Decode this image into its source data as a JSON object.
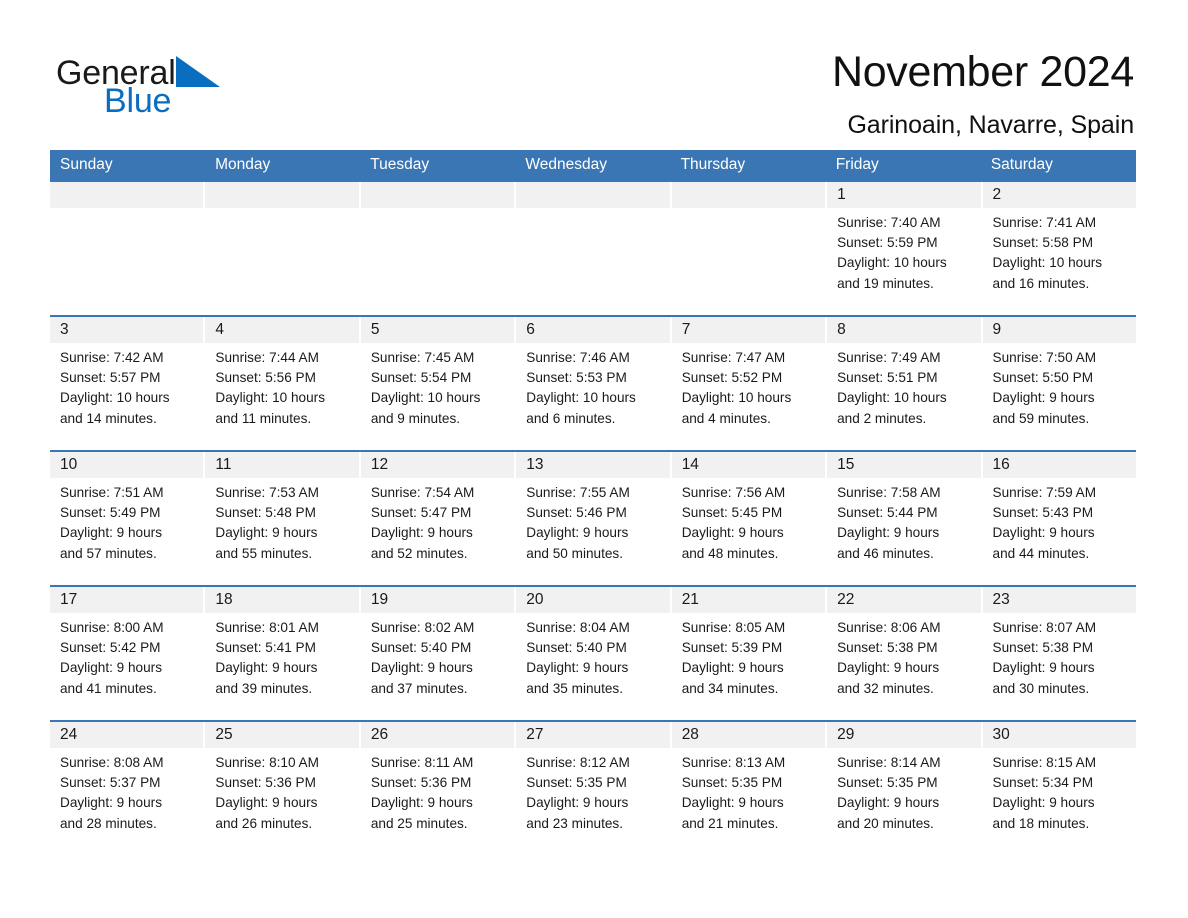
{
  "brand": {
    "name_part1": "General",
    "name_part2": "Blue",
    "logo_icon": "triangle-mark",
    "accent_color": "#0a6ec0"
  },
  "header": {
    "month_title": "November 2024",
    "location": "Garinoain, Navarre, Spain"
  },
  "calendar": {
    "header_color": "#3b76b4",
    "daynum_band_color": "#f1f1f1",
    "weekdays": [
      "Sunday",
      "Monday",
      "Tuesday",
      "Wednesday",
      "Thursday",
      "Friday",
      "Saturday"
    ],
    "weeks": [
      [
        {
          "day": "",
          "sunrise": "",
          "sunset": "",
          "daylight_line1": "",
          "daylight_line2": ""
        },
        {
          "day": "",
          "sunrise": "",
          "sunset": "",
          "daylight_line1": "",
          "daylight_line2": ""
        },
        {
          "day": "",
          "sunrise": "",
          "sunset": "",
          "daylight_line1": "",
          "daylight_line2": ""
        },
        {
          "day": "",
          "sunrise": "",
          "sunset": "",
          "daylight_line1": "",
          "daylight_line2": ""
        },
        {
          "day": "",
          "sunrise": "",
          "sunset": "",
          "daylight_line1": "",
          "daylight_line2": ""
        },
        {
          "day": "1",
          "sunrise": "Sunrise: 7:40 AM",
          "sunset": "Sunset: 5:59 PM",
          "daylight_line1": "Daylight: 10 hours",
          "daylight_line2": "and 19 minutes."
        },
        {
          "day": "2",
          "sunrise": "Sunrise: 7:41 AM",
          "sunset": "Sunset: 5:58 PM",
          "daylight_line1": "Daylight: 10 hours",
          "daylight_line2": "and 16 minutes."
        }
      ],
      [
        {
          "day": "3",
          "sunrise": "Sunrise: 7:42 AM",
          "sunset": "Sunset: 5:57 PM",
          "daylight_line1": "Daylight: 10 hours",
          "daylight_line2": "and 14 minutes."
        },
        {
          "day": "4",
          "sunrise": "Sunrise: 7:44 AM",
          "sunset": "Sunset: 5:56 PM",
          "daylight_line1": "Daylight: 10 hours",
          "daylight_line2": "and 11 minutes."
        },
        {
          "day": "5",
          "sunrise": "Sunrise: 7:45 AM",
          "sunset": "Sunset: 5:54 PM",
          "daylight_line1": "Daylight: 10 hours",
          "daylight_line2": "and 9 minutes."
        },
        {
          "day": "6",
          "sunrise": "Sunrise: 7:46 AM",
          "sunset": "Sunset: 5:53 PM",
          "daylight_line1": "Daylight: 10 hours",
          "daylight_line2": "and 6 minutes."
        },
        {
          "day": "7",
          "sunrise": "Sunrise: 7:47 AM",
          "sunset": "Sunset: 5:52 PM",
          "daylight_line1": "Daylight: 10 hours",
          "daylight_line2": "and 4 minutes."
        },
        {
          "day": "8",
          "sunrise": "Sunrise: 7:49 AM",
          "sunset": "Sunset: 5:51 PM",
          "daylight_line1": "Daylight: 10 hours",
          "daylight_line2": "and 2 minutes."
        },
        {
          "day": "9",
          "sunrise": "Sunrise: 7:50 AM",
          "sunset": "Sunset: 5:50 PM",
          "daylight_line1": "Daylight: 9 hours",
          "daylight_line2": "and 59 minutes."
        }
      ],
      [
        {
          "day": "10",
          "sunrise": "Sunrise: 7:51 AM",
          "sunset": "Sunset: 5:49 PM",
          "daylight_line1": "Daylight: 9 hours",
          "daylight_line2": "and 57 minutes."
        },
        {
          "day": "11",
          "sunrise": "Sunrise: 7:53 AM",
          "sunset": "Sunset: 5:48 PM",
          "daylight_line1": "Daylight: 9 hours",
          "daylight_line2": "and 55 minutes."
        },
        {
          "day": "12",
          "sunrise": "Sunrise: 7:54 AM",
          "sunset": "Sunset: 5:47 PM",
          "daylight_line1": "Daylight: 9 hours",
          "daylight_line2": "and 52 minutes."
        },
        {
          "day": "13",
          "sunrise": "Sunrise: 7:55 AM",
          "sunset": "Sunset: 5:46 PM",
          "daylight_line1": "Daylight: 9 hours",
          "daylight_line2": "and 50 minutes."
        },
        {
          "day": "14",
          "sunrise": "Sunrise: 7:56 AM",
          "sunset": "Sunset: 5:45 PM",
          "daylight_line1": "Daylight: 9 hours",
          "daylight_line2": "and 48 minutes."
        },
        {
          "day": "15",
          "sunrise": "Sunrise: 7:58 AM",
          "sunset": "Sunset: 5:44 PM",
          "daylight_line1": "Daylight: 9 hours",
          "daylight_line2": "and 46 minutes."
        },
        {
          "day": "16",
          "sunrise": "Sunrise: 7:59 AM",
          "sunset": "Sunset: 5:43 PM",
          "daylight_line1": "Daylight: 9 hours",
          "daylight_line2": "and 44 minutes."
        }
      ],
      [
        {
          "day": "17",
          "sunrise": "Sunrise: 8:00 AM",
          "sunset": "Sunset: 5:42 PM",
          "daylight_line1": "Daylight: 9 hours",
          "daylight_line2": "and 41 minutes."
        },
        {
          "day": "18",
          "sunrise": "Sunrise: 8:01 AM",
          "sunset": "Sunset: 5:41 PM",
          "daylight_line1": "Daylight: 9 hours",
          "daylight_line2": "and 39 minutes."
        },
        {
          "day": "19",
          "sunrise": "Sunrise: 8:02 AM",
          "sunset": "Sunset: 5:40 PM",
          "daylight_line1": "Daylight: 9 hours",
          "daylight_line2": "and 37 minutes."
        },
        {
          "day": "20",
          "sunrise": "Sunrise: 8:04 AM",
          "sunset": "Sunset: 5:40 PM",
          "daylight_line1": "Daylight: 9 hours",
          "daylight_line2": "and 35 minutes."
        },
        {
          "day": "21",
          "sunrise": "Sunrise: 8:05 AM",
          "sunset": "Sunset: 5:39 PM",
          "daylight_line1": "Daylight: 9 hours",
          "daylight_line2": "and 34 minutes."
        },
        {
          "day": "22",
          "sunrise": "Sunrise: 8:06 AM",
          "sunset": "Sunset: 5:38 PM",
          "daylight_line1": "Daylight: 9 hours",
          "daylight_line2": "and 32 minutes."
        },
        {
          "day": "23",
          "sunrise": "Sunrise: 8:07 AM",
          "sunset": "Sunset: 5:38 PM",
          "daylight_line1": "Daylight: 9 hours",
          "daylight_line2": "and 30 minutes."
        }
      ],
      [
        {
          "day": "24",
          "sunrise": "Sunrise: 8:08 AM",
          "sunset": "Sunset: 5:37 PM",
          "daylight_line1": "Daylight: 9 hours",
          "daylight_line2": "and 28 minutes."
        },
        {
          "day": "25",
          "sunrise": "Sunrise: 8:10 AM",
          "sunset": "Sunset: 5:36 PM",
          "daylight_line1": "Daylight: 9 hours",
          "daylight_line2": "and 26 minutes."
        },
        {
          "day": "26",
          "sunrise": "Sunrise: 8:11 AM",
          "sunset": "Sunset: 5:36 PM",
          "daylight_line1": "Daylight: 9 hours",
          "daylight_line2": "and 25 minutes."
        },
        {
          "day": "27",
          "sunrise": "Sunrise: 8:12 AM",
          "sunset": "Sunset: 5:35 PM",
          "daylight_line1": "Daylight: 9 hours",
          "daylight_line2": "and 23 minutes."
        },
        {
          "day": "28",
          "sunrise": "Sunrise: 8:13 AM",
          "sunset": "Sunset: 5:35 PM",
          "daylight_line1": "Daylight: 9 hours",
          "daylight_line2": "and 21 minutes."
        },
        {
          "day": "29",
          "sunrise": "Sunrise: 8:14 AM",
          "sunset": "Sunset: 5:35 PM",
          "daylight_line1": "Daylight: 9 hours",
          "daylight_line2": "and 20 minutes."
        },
        {
          "day": "30",
          "sunrise": "Sunrise: 8:15 AM",
          "sunset": "Sunset: 5:34 PM",
          "daylight_line1": "Daylight: 9 hours",
          "daylight_line2": "and 18 minutes."
        }
      ]
    ]
  }
}
